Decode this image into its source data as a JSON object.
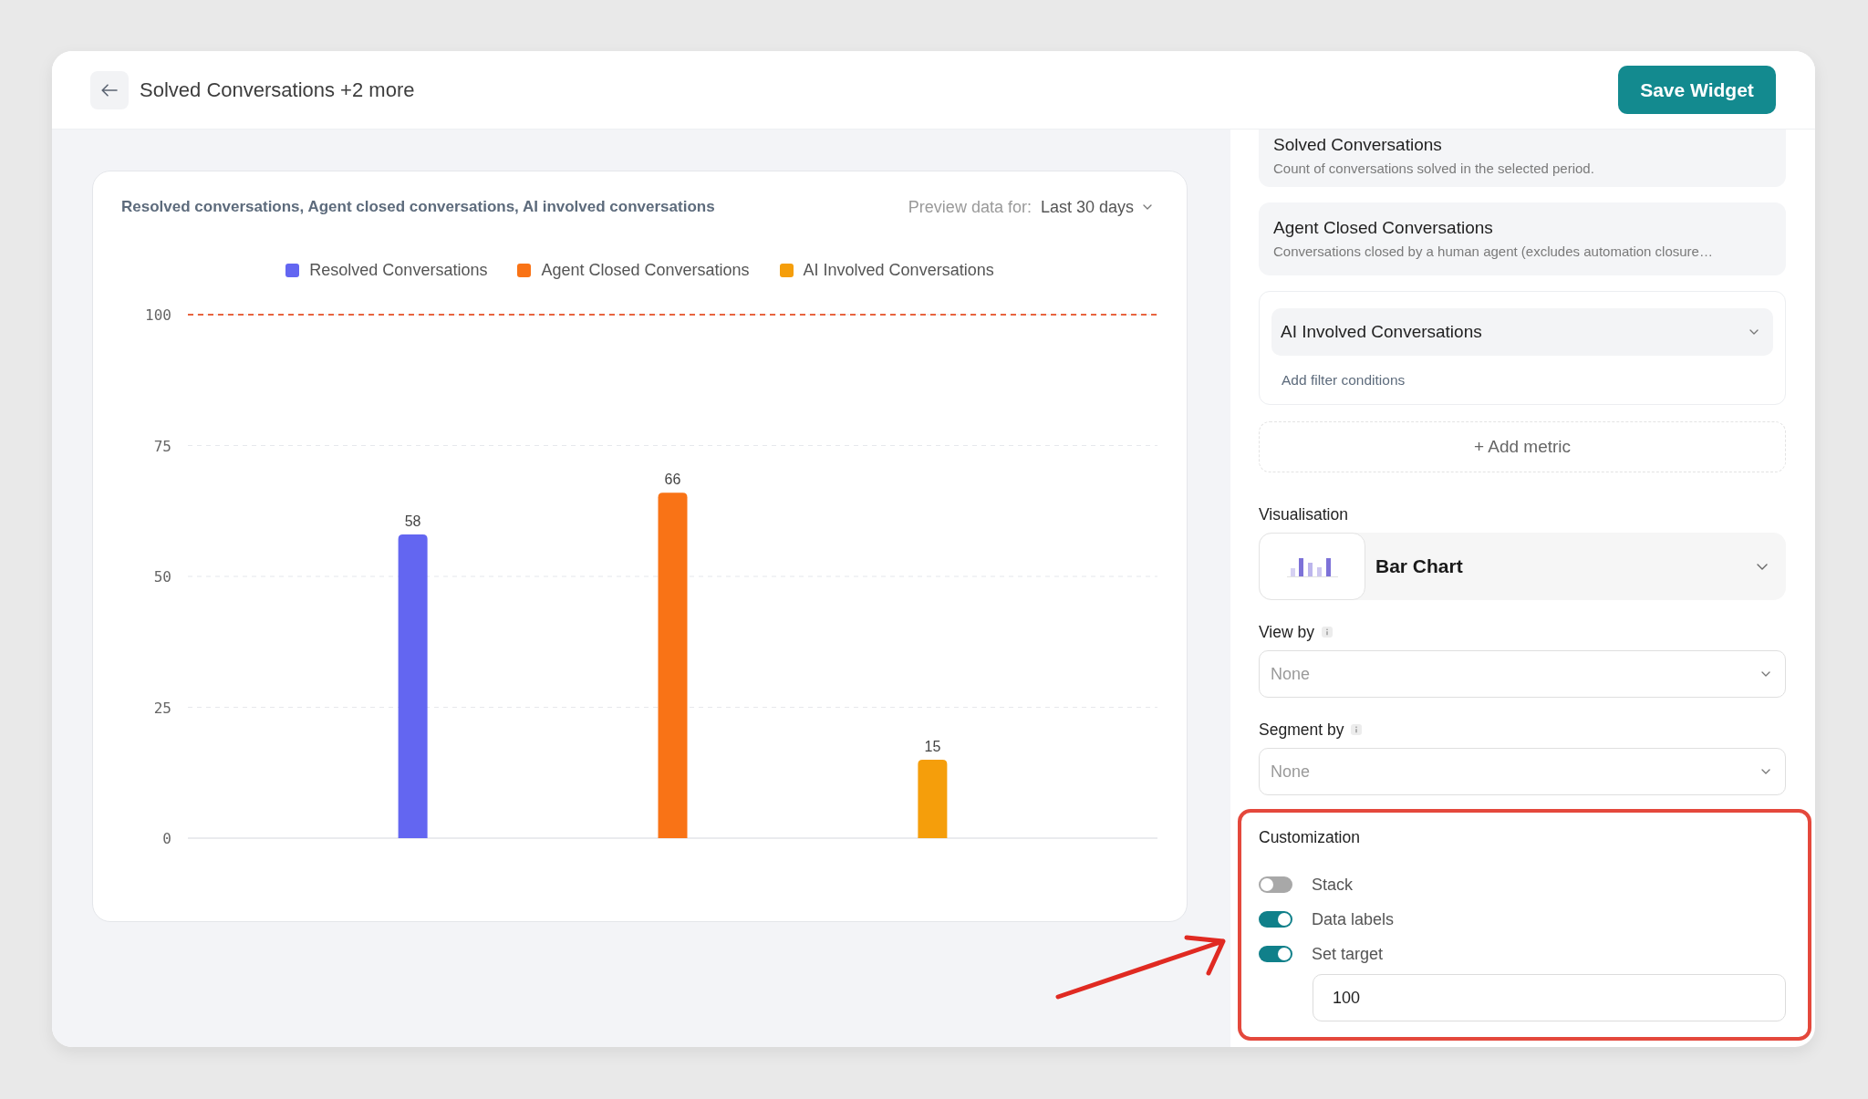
{
  "header": {
    "title": "Solved Conversations +2 more",
    "save_button": "Save Widget"
  },
  "chart_card": {
    "title": "Resolved conversations, Agent closed conversations, AI involved conversations",
    "preview_label": "Preview data for:",
    "preview_range": "Last 30 days",
    "chart_data": {
      "type": "bar",
      "series": [
        {
          "name": "Resolved Conversations",
          "color": "#6366f1",
          "values": [
            58
          ]
        },
        {
          "name": "Agent Closed Conversations",
          "color": "#f97316",
          "values": [
            66
          ]
        },
        {
          "name": "AI Involved Conversations",
          "color": "#f59e0b",
          "values": [
            15
          ]
        }
      ],
      "ylim": [
        0,
        100
      ],
      "yticks": [
        0,
        25,
        50,
        75,
        100
      ],
      "grid": true,
      "stacked": false,
      "data_labels": true,
      "ref_lines": [
        {
          "axis": "y",
          "value": 100,
          "color": "#e8643f"
        }
      ]
    }
  },
  "settings_panel": {
    "metrics": [
      {
        "kind": "summary",
        "name": "Solved Conversations",
        "description": "Count of conversations solved in the selected period."
      },
      {
        "kind": "summary",
        "name": "Agent Closed Conversations",
        "description": "Conversations closed by a human agent (excludes automation closure…"
      },
      {
        "kind": "editor",
        "name": "AI Involved Conversations",
        "filter_link": "Add filter conditions"
      }
    ],
    "add_metric": "+ Add metric",
    "visualisation": {
      "label": "Visualisation",
      "value": "Bar Chart"
    },
    "view_by": {
      "label": "View by",
      "placeholder": "None"
    },
    "segment_by": {
      "label": "Segment by",
      "placeholder": "None"
    },
    "customization": {
      "title": "Customization",
      "options": [
        {
          "label": "Stack",
          "on": false
        },
        {
          "label": "Data labels",
          "on": true
        },
        {
          "label": "Set target",
          "on": true,
          "value": "100"
        }
      ]
    }
  }
}
